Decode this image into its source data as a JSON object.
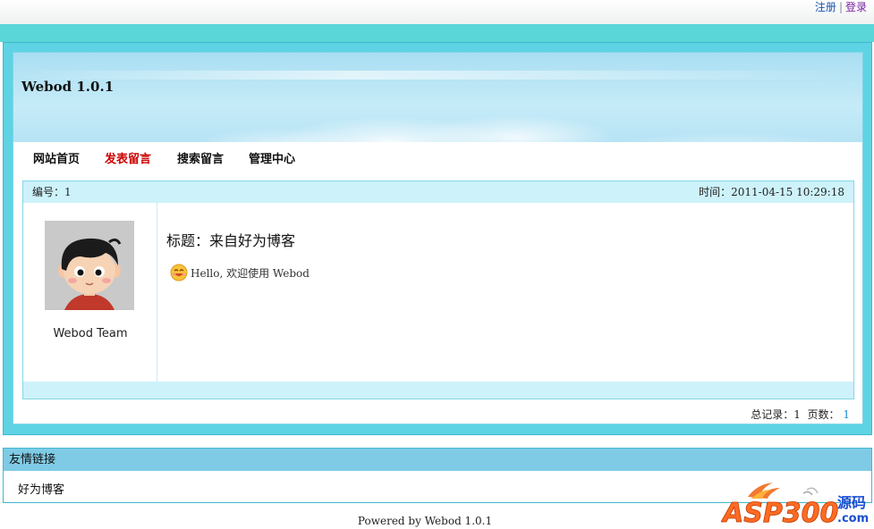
{
  "topbar": {
    "register": "注册",
    "separator": "|",
    "login": "登录"
  },
  "banner": {
    "logo": "Webod 1.0.1"
  },
  "nav": {
    "items": [
      {
        "label": "网站首页"
      },
      {
        "label": "发表留言",
        "active": true
      },
      {
        "label": "搜索留言"
      },
      {
        "label": "管理中心"
      }
    ]
  },
  "message": {
    "id_text": "编号：1",
    "time_text": "时间：2011-04-15 10:29:18",
    "username": "Webod Team",
    "title": "标题：来自好为博客",
    "body": "Hello, 欢迎使用 Webod"
  },
  "pager": {
    "total_label": "总记录：",
    "total": "1",
    "pages_label": "页数：",
    "page": "1"
  },
  "links": {
    "header": "友情链接",
    "items": [
      "好为博客"
    ]
  },
  "footer": {
    "text": "Powered by Webod 1.0.1"
  },
  "watermark": {
    "text": "ASP300",
    "suffix": "源码",
    "domain": ".com"
  },
  "colors": {
    "accent": "#5ed3e4",
    "active_nav": "#cc0000",
    "header_bg": "#cdf2fa",
    "links_header": "#7fcbe6"
  }
}
